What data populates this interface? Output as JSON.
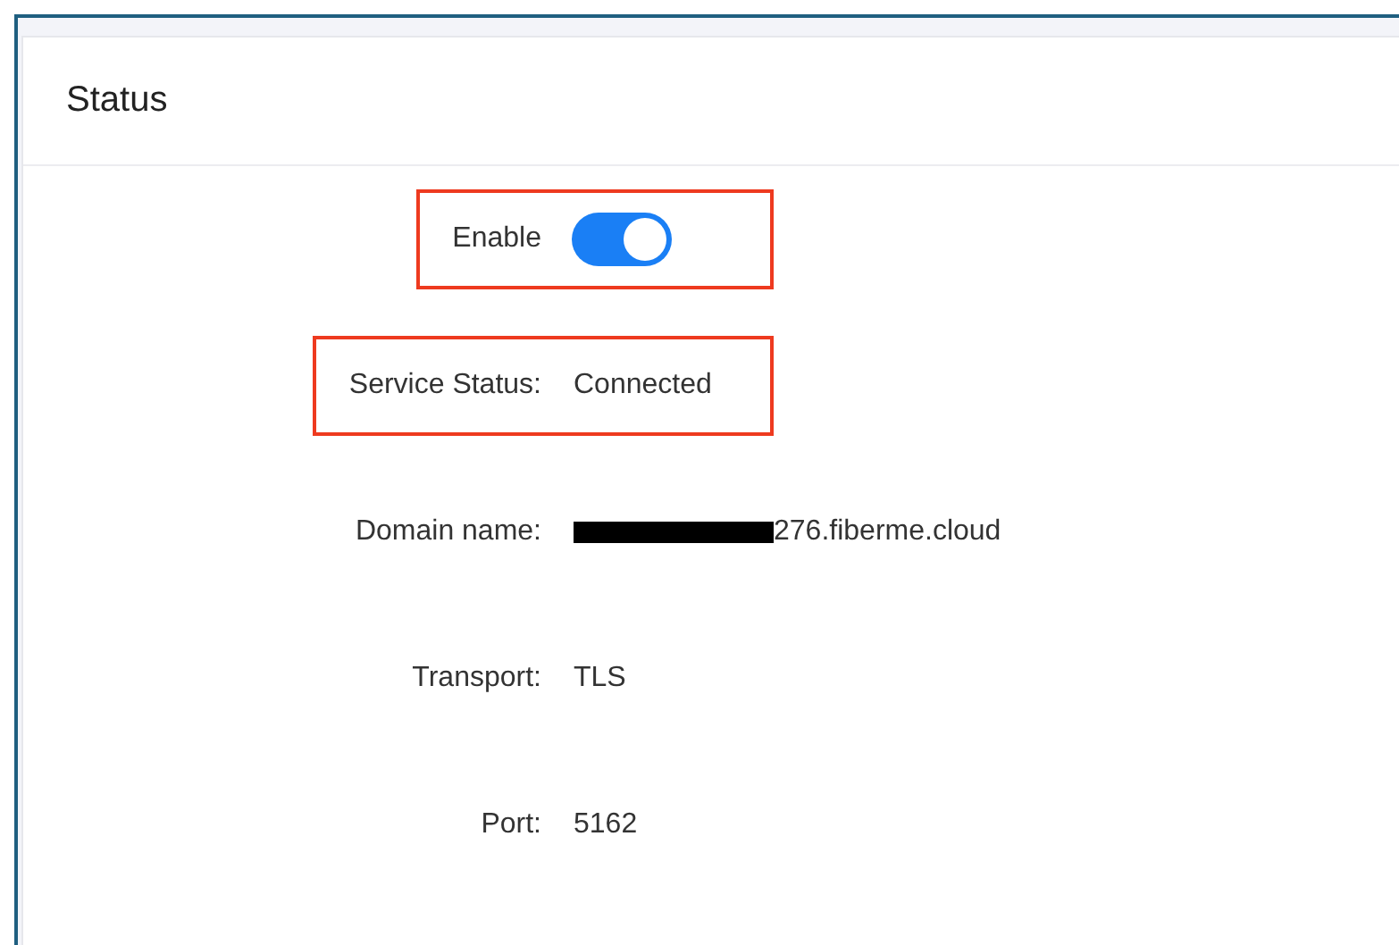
{
  "panel": {
    "title": "Status"
  },
  "fields": [
    {
      "label": "Enable",
      "kind": "toggle",
      "on": true,
      "highlighted": true
    },
    {
      "label": "Service Status:",
      "kind": "text",
      "value": "Connected",
      "highlighted": true
    },
    {
      "label": "Domain name:",
      "kind": "text",
      "value": "276.fiberme.cloud",
      "redacted": true,
      "highlighted": false
    },
    {
      "label": "Transport:",
      "kind": "text",
      "value": "TLS",
      "highlighted": false
    },
    {
      "label": "Port:",
      "kind": "text",
      "value": "5162",
      "highlighted": false
    }
  ]
}
